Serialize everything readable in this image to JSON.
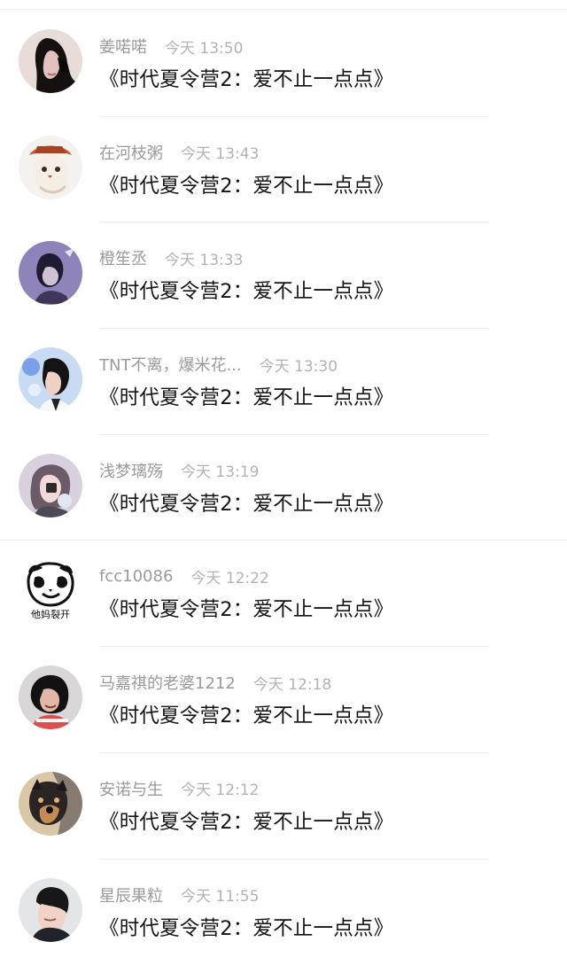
{
  "comments": [
    {
      "username": "姜喏喏",
      "time": "今天 13:50",
      "text": "《时代夏令营2：爱不止一点点》",
      "avatar_icon": "avatar-dark-hair-icon"
    },
    {
      "username": "在河枝粥",
      "time": "今天 13:43",
      "text": "《时代夏令营2：爱不止一点点》",
      "avatar_icon": "avatar-cat-hat-icon"
    },
    {
      "username": "橙笙丞",
      "time": "今天 13:33",
      "text": "《时代夏令营2：爱不止一点点》",
      "avatar_icon": "avatar-purple-portrait-icon"
    },
    {
      "username": "TNT不离，爆米花...",
      "time": "今天 13:30",
      "text": "《时代夏令营2：爱不止一点点》",
      "avatar_icon": "avatar-boy-blue-background-icon"
    },
    {
      "username": "浅梦璃殇",
      "time": "今天 13:19",
      "text": "《时代夏令营2：爱不止一点点》",
      "avatar_icon": "avatar-girl-pink-icon"
    },
    {
      "username": "fcc10086",
      "time": "今天 12:22",
      "text": "《时代夏令营2：爱不止一点点》",
      "avatar_icon": "avatar-panda-meme-icon",
      "avatar_caption": "他妈裂开"
    },
    {
      "username": "马嘉祺的老婆1212",
      "time": "今天 12:18",
      "text": "《时代夏令营2：爱不止一点点》",
      "avatar_icon": "avatar-boy-red-shirt-icon"
    },
    {
      "username": "安诺与生",
      "time": "今天 12:12",
      "text": "《时代夏令营2：爱不止一点点》",
      "avatar_icon": "avatar-dog-icon"
    },
    {
      "username": "星辰果粒",
      "time": "今天 11:55",
      "text": "《时代夏令营2：爱不止一点点》",
      "avatar_icon": "avatar-boy-portrait-icon"
    }
  ],
  "colors": {
    "username": "#9a9a9a",
    "time": "#b3b3b3",
    "text": "#151515",
    "divider": "#f0f0f0"
  }
}
